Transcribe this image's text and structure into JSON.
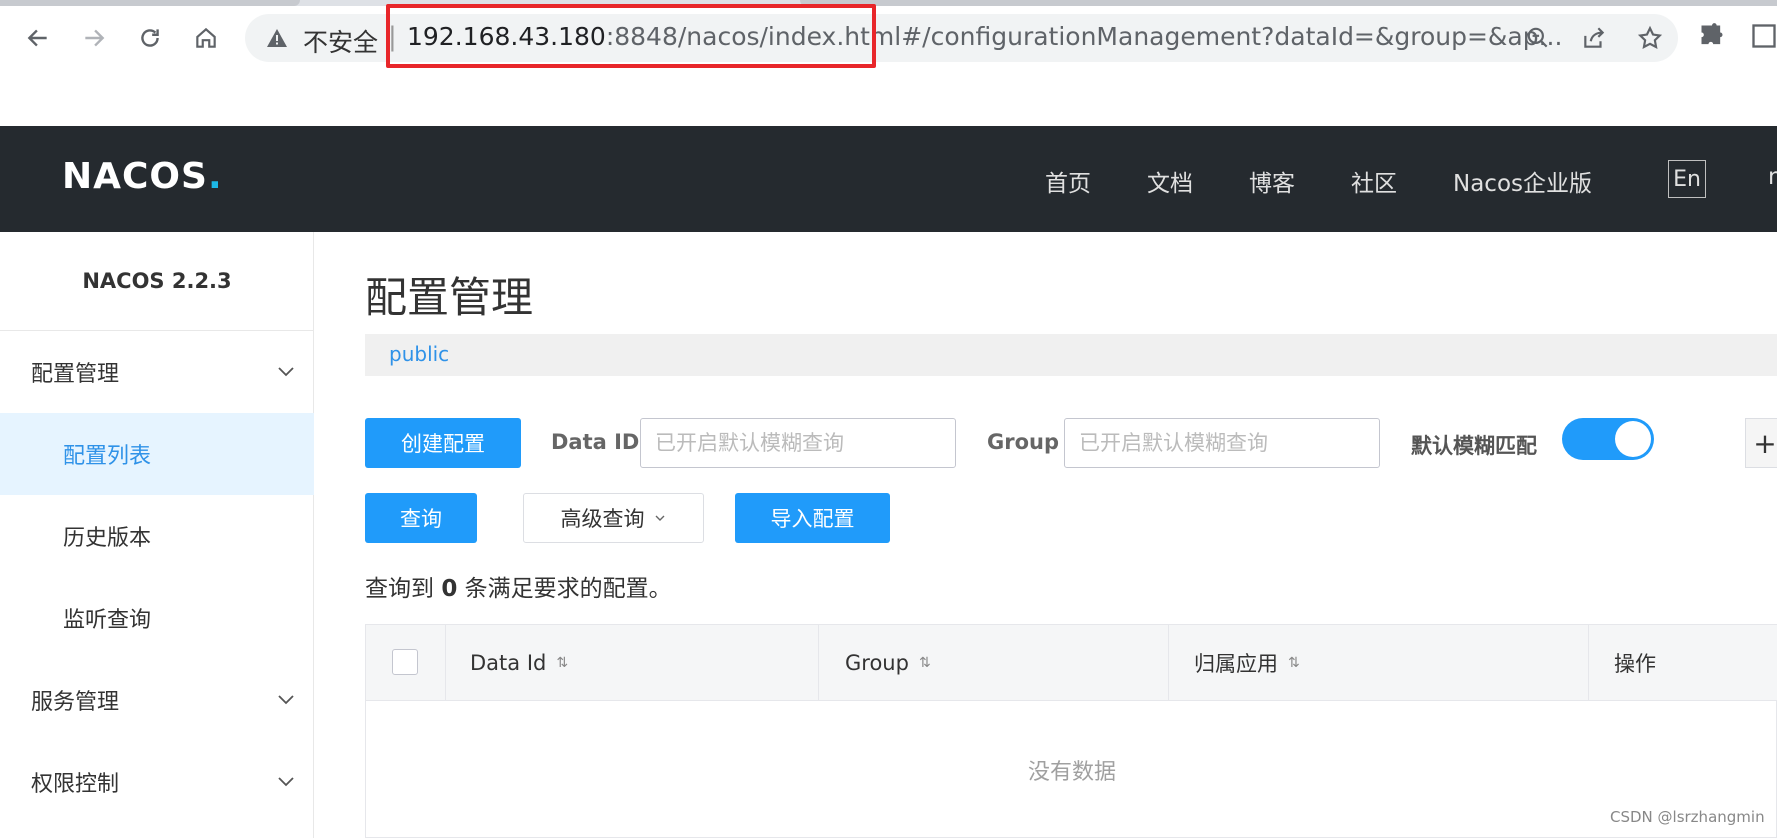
{
  "browser": {
    "not_secure_label": "不安全",
    "url_host": "192.168.43.180",
    "url_rest": ":8848/nacos/index.html#/configurationManagement?dataId=&group=&ap..."
  },
  "header": {
    "logo": "NACOS",
    "logo_dot": ".",
    "nav": [
      "首页",
      "文档",
      "博客",
      "社区",
      "Nacos企业版"
    ],
    "lang_button": "En",
    "extra_partial": "n"
  },
  "sidebar": {
    "version": "NACOS 2.2.3",
    "groups": [
      {
        "label": "配置管理"
      },
      {
        "label": "服务管理"
      },
      {
        "label": "权限控制"
      }
    ],
    "items": [
      {
        "label": "配置列表",
        "active": true
      },
      {
        "label": "历史版本"
      },
      {
        "label": "监听查询"
      }
    ]
  },
  "main": {
    "title": "配置管理",
    "namespace": "public",
    "create_button": "创建配置",
    "data_id_label": "Data ID",
    "data_id_placeholder": "已开启默认模糊查询",
    "group_label": "Group",
    "group_placeholder": "已开启默认模糊查询",
    "fuzzy_label": "默认模糊匹配",
    "fuzzy_enabled": true,
    "plus_button": "+",
    "query_button": "查询",
    "advanced_query_button": "高级查询",
    "import_button": "导入配置",
    "result_prefix": "查询到",
    "result_count": "0",
    "result_suffix": "条满足要求的配置。",
    "table": {
      "columns": [
        "Data Id",
        "Group",
        "归属应用",
        "操作"
      ],
      "empty_text": "没有数据"
    }
  },
  "watermark": "CSDN @lsrzhangmin"
}
